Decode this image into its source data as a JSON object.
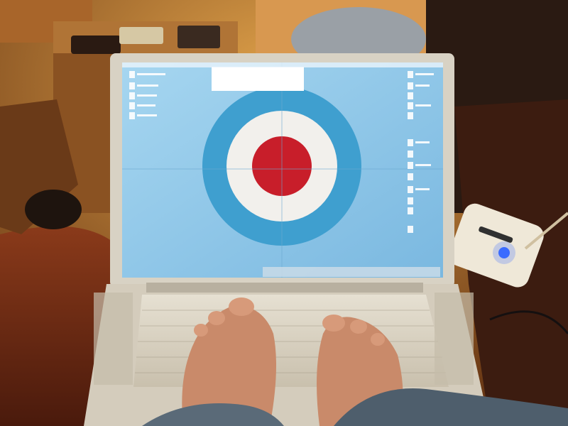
{
  "photo": {
    "subject": "laptop-on-lap-with-feet-on-keyboard",
    "colors": {
      "wall": "#c88a3a",
      "furniture": "#7a4a1c",
      "blanket": "#6a2814",
      "screen_sky": "#8fc8ea",
      "roundel_blue": "#3f9fcf",
      "roundel_white": "#f2f0ec",
      "roundel_red": "#c81e2a",
      "laptop_body": "#d9d2c3",
      "skin": "#c98a6a",
      "denim": "#5a6a78",
      "led": "#3a6bff"
    }
  }
}
